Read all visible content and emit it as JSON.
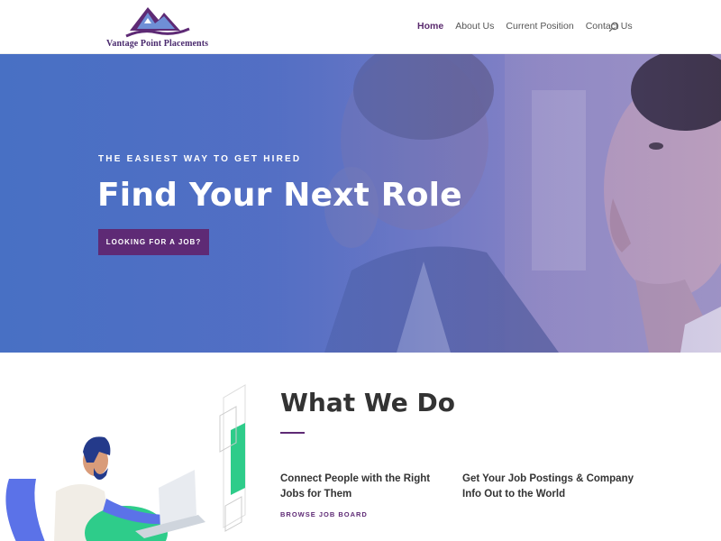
{
  "header": {
    "logo_text": "Vantage Point Placements",
    "nav": [
      {
        "label": "Home",
        "active": true
      },
      {
        "label": "About Us",
        "active": false
      },
      {
        "label": "Current Position",
        "active": false
      },
      {
        "label": "Contact Us",
        "active": false
      }
    ],
    "search_icon": "search-icon"
  },
  "hero": {
    "eyebrow": "THE EASIEST WAY TO GET HIRED",
    "title": "Find Your Next Role",
    "button_label": "LOOKING FOR A JOB?"
  },
  "what_we_do": {
    "title": "What We Do",
    "feature_1": "Connect People with the Right Jobs for Them",
    "feature_1_link": "BROWSE JOB BOARD",
    "feature_2": "Get Your Job Postings & Company Info Out to the World"
  },
  "colors": {
    "brand_purple": "#5e2a75",
    "hero_blue": "#4b70c2",
    "accent_green": "#2ecc8a"
  }
}
